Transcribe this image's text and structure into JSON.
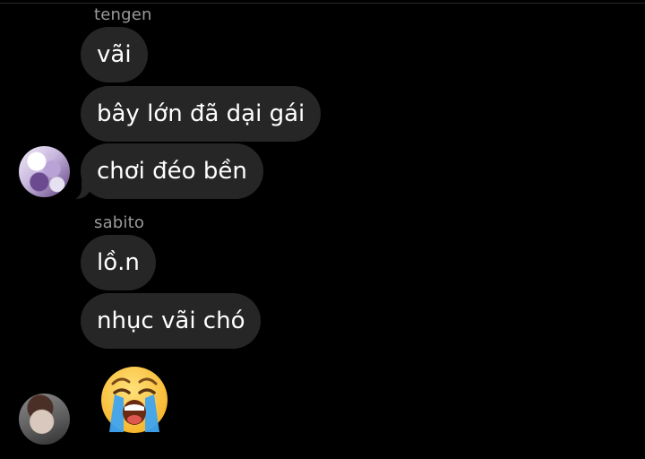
{
  "chat": {
    "groups": [
      {
        "sender": "tengen",
        "messages": [
          "vãi",
          "bây lớn đã dại gái",
          "chơi đéo bền"
        ],
        "avatar_icon": "anime-girl-avatar"
      },
      {
        "sender": "sabito",
        "messages": [
          "lồ.n",
          "nhục vãi chó"
        ],
        "emoji_message": "loudly-crying-face",
        "avatar_icon": "person-photo-avatar"
      }
    ]
  },
  "colors": {
    "background": "#000000",
    "bubble": "#262626",
    "sender_name": "#9a9a9a",
    "text": "#ffffff",
    "emoji_face": "#ffcc33",
    "emoji_tears": "#3fa4f0"
  }
}
